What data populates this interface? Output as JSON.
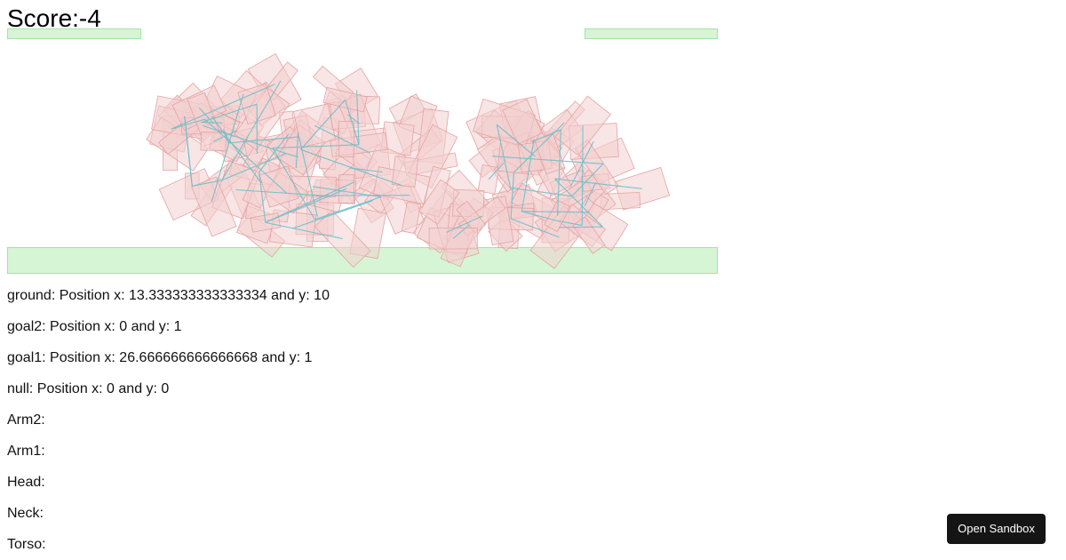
{
  "hud": {
    "score_text": "Score:-4"
  },
  "colors": {
    "static_fill": "#d5f5d5",
    "static_stroke": "#a6e3a6",
    "block_fill": "#f2cfcf",
    "block_stroke": "#e5a3a3",
    "joint_line": "#6bbfca",
    "button_bg": "#151515",
    "button_text": "#ffffff"
  },
  "bodies": [
    {
      "name": "ground",
      "label": "ground",
      "x": "13.333333333333334",
      "y": "10"
    },
    {
      "name": "goal2",
      "label": "goal2",
      "x": "0",
      "y": "1"
    },
    {
      "name": "goal1",
      "label": "goal1",
      "x": "26.666666666666668",
      "y": "1"
    },
    {
      "name": "null",
      "label": "null",
      "x": "0",
      "y": "0"
    }
  ],
  "info_rows": [
    "ground: Position x: 13.333333333333334 and y: 10",
    "goal2: Position x: 0 and y: 1",
    "goal1: Position x: 26.666666666666668 and y: 1",
    "null: Position x: 0 and y: 0",
    "Arm2:",
    "Arm1:",
    "Head:",
    "Neck:",
    "Torso:"
  ],
  "controls": {
    "open_sandbox_label": "Open Sandbox"
  }
}
